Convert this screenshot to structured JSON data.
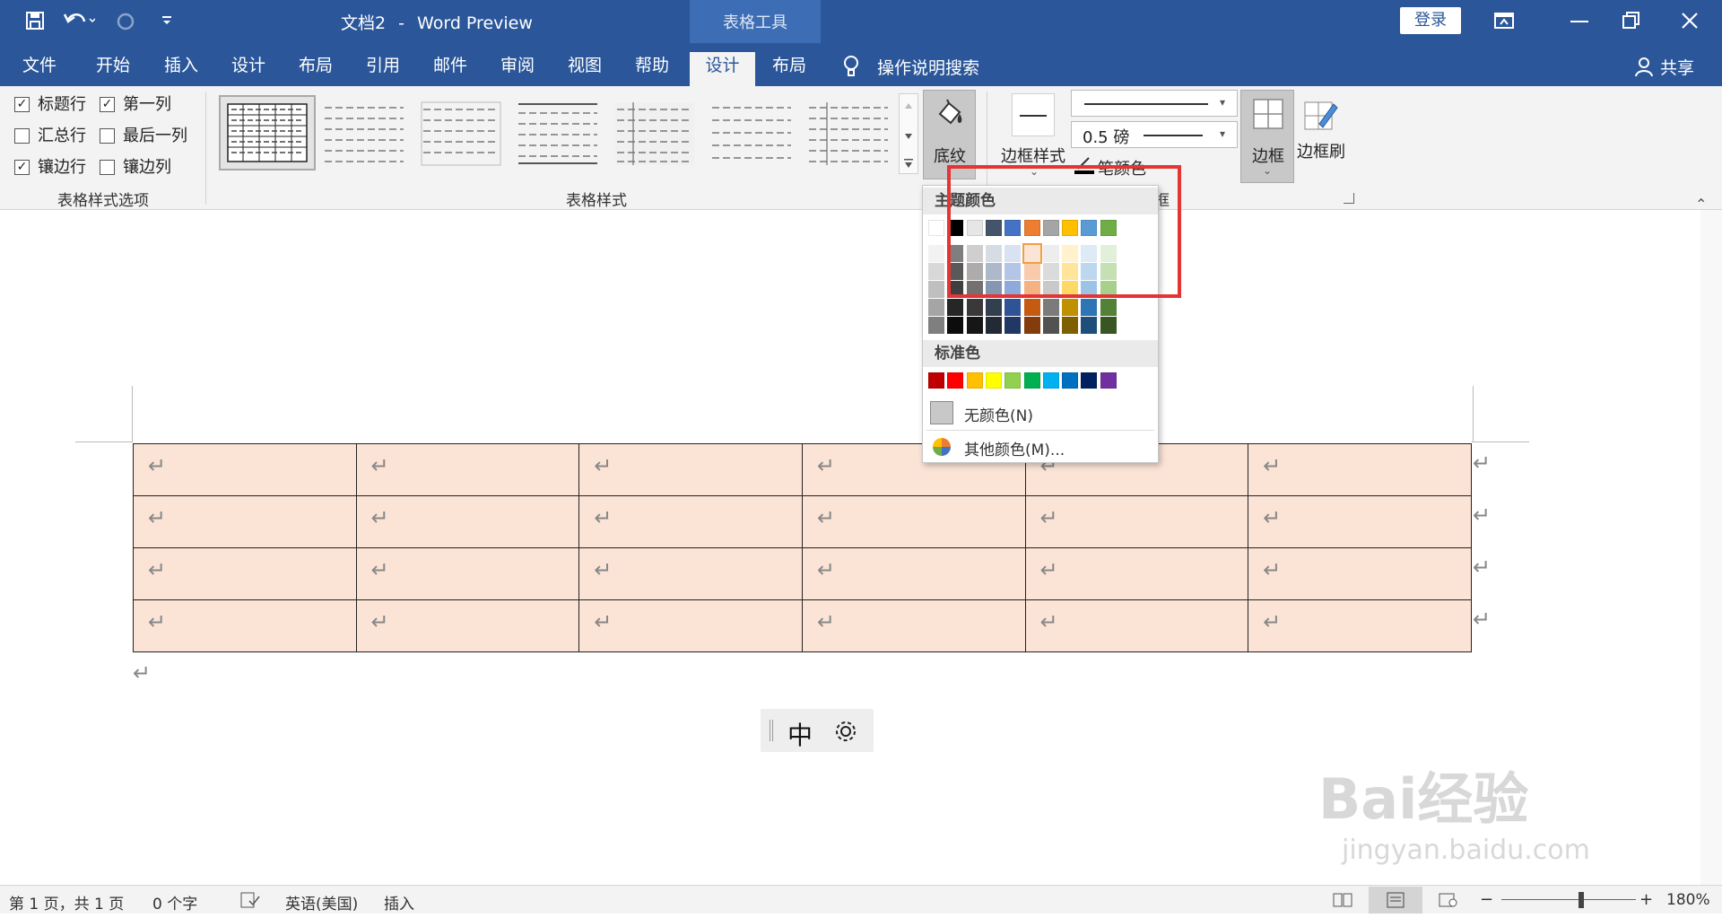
{
  "titlebar": {
    "doc_name": "文档2",
    "dash": "-",
    "app_name": "Word Preview",
    "context_tab": "表格工具",
    "login": "登录"
  },
  "tabs": [
    "文件",
    "开始",
    "插入",
    "设计",
    "布局",
    "引用",
    "邮件",
    "审阅",
    "视图",
    "帮助",
    "设计",
    "布局"
  ],
  "tell_me": "操作说明搜索",
  "share": "共享",
  "ribbon": {
    "options": {
      "header_row": "标题行",
      "first_col": "第一列",
      "total_row": "汇总行",
      "last_col": "最后一列",
      "banded_rows": "镶边行",
      "banded_cols": "镶边列",
      "group_label": "表格样式选项"
    },
    "styles_group_label": "表格样式",
    "shading": "底纹",
    "border_styles": "边框样式",
    "pen_weight": "0.5 磅",
    "pen_color": "笔颜色",
    "borders": "边框",
    "border_painter": "边框刷",
    "borders_group_tail": "边框"
  },
  "dropdown": {
    "theme_colors_label": "主题颜色",
    "standard_colors_label": "标准色",
    "no_color": "无颜色(N)",
    "more_colors": "其他颜色(M)...",
    "theme_top": [
      "#ffffff",
      "#000000",
      "#e7e6e6",
      "#44546a",
      "#4472c4",
      "#ed7d31",
      "#a5a5a5",
      "#ffc000",
      "#5b9bd5",
      "#70ad47"
    ],
    "theme_shades": [
      [
        "#f2f2f2",
        "#7f7f7f",
        "#d0cece",
        "#d6dce4",
        "#d9e2f3",
        "#fbe4d5",
        "#ededed",
        "#fff2cc",
        "#deebf6",
        "#e2efd9"
      ],
      [
        "#d8d8d8",
        "#595959",
        "#aeabab",
        "#adb9ca",
        "#b4c6e7",
        "#f7cbac",
        "#dbdbdb",
        "#fee599",
        "#bdd7ee",
        "#c5e0b3"
      ],
      [
        "#bfbfbf",
        "#3f3f3f",
        "#757070",
        "#8496b0",
        "#8eaadb",
        "#f4b183",
        "#c9c9c9",
        "#ffd965",
        "#9cc3e5",
        "#a8d08d"
      ],
      [
        "#a5a5a5",
        "#262626",
        "#3a3838",
        "#323f4f",
        "#2f5496",
        "#c55a11",
        "#7b7b7b",
        "#bf9000",
        "#2e75b5",
        "#538135"
      ],
      [
        "#7f7f7f",
        "#0c0c0c",
        "#171616",
        "#222a35",
        "#1f3864",
        "#833c0b",
        "#525252",
        "#7f6000",
        "#1e4e79",
        "#375623"
      ]
    ],
    "standard": [
      "#c00000",
      "#ff0000",
      "#ffc000",
      "#ffff00",
      "#92d050",
      "#00b050",
      "#00b0f0",
      "#0070c0",
      "#002060",
      "#7030a0"
    ]
  },
  "document": {
    "return_mark": "↵",
    "table_rows": 4,
    "table_cols": 6
  },
  "ime": {
    "mode": "中"
  },
  "statusbar": {
    "page": "第 1 页，共 1 页",
    "words": "0 个字",
    "language": "英语(美国)",
    "mode": "插入",
    "zoom": "180%"
  },
  "watermark": {
    "text": "Bai经验",
    "url": "jingyan.baidu.com"
  }
}
